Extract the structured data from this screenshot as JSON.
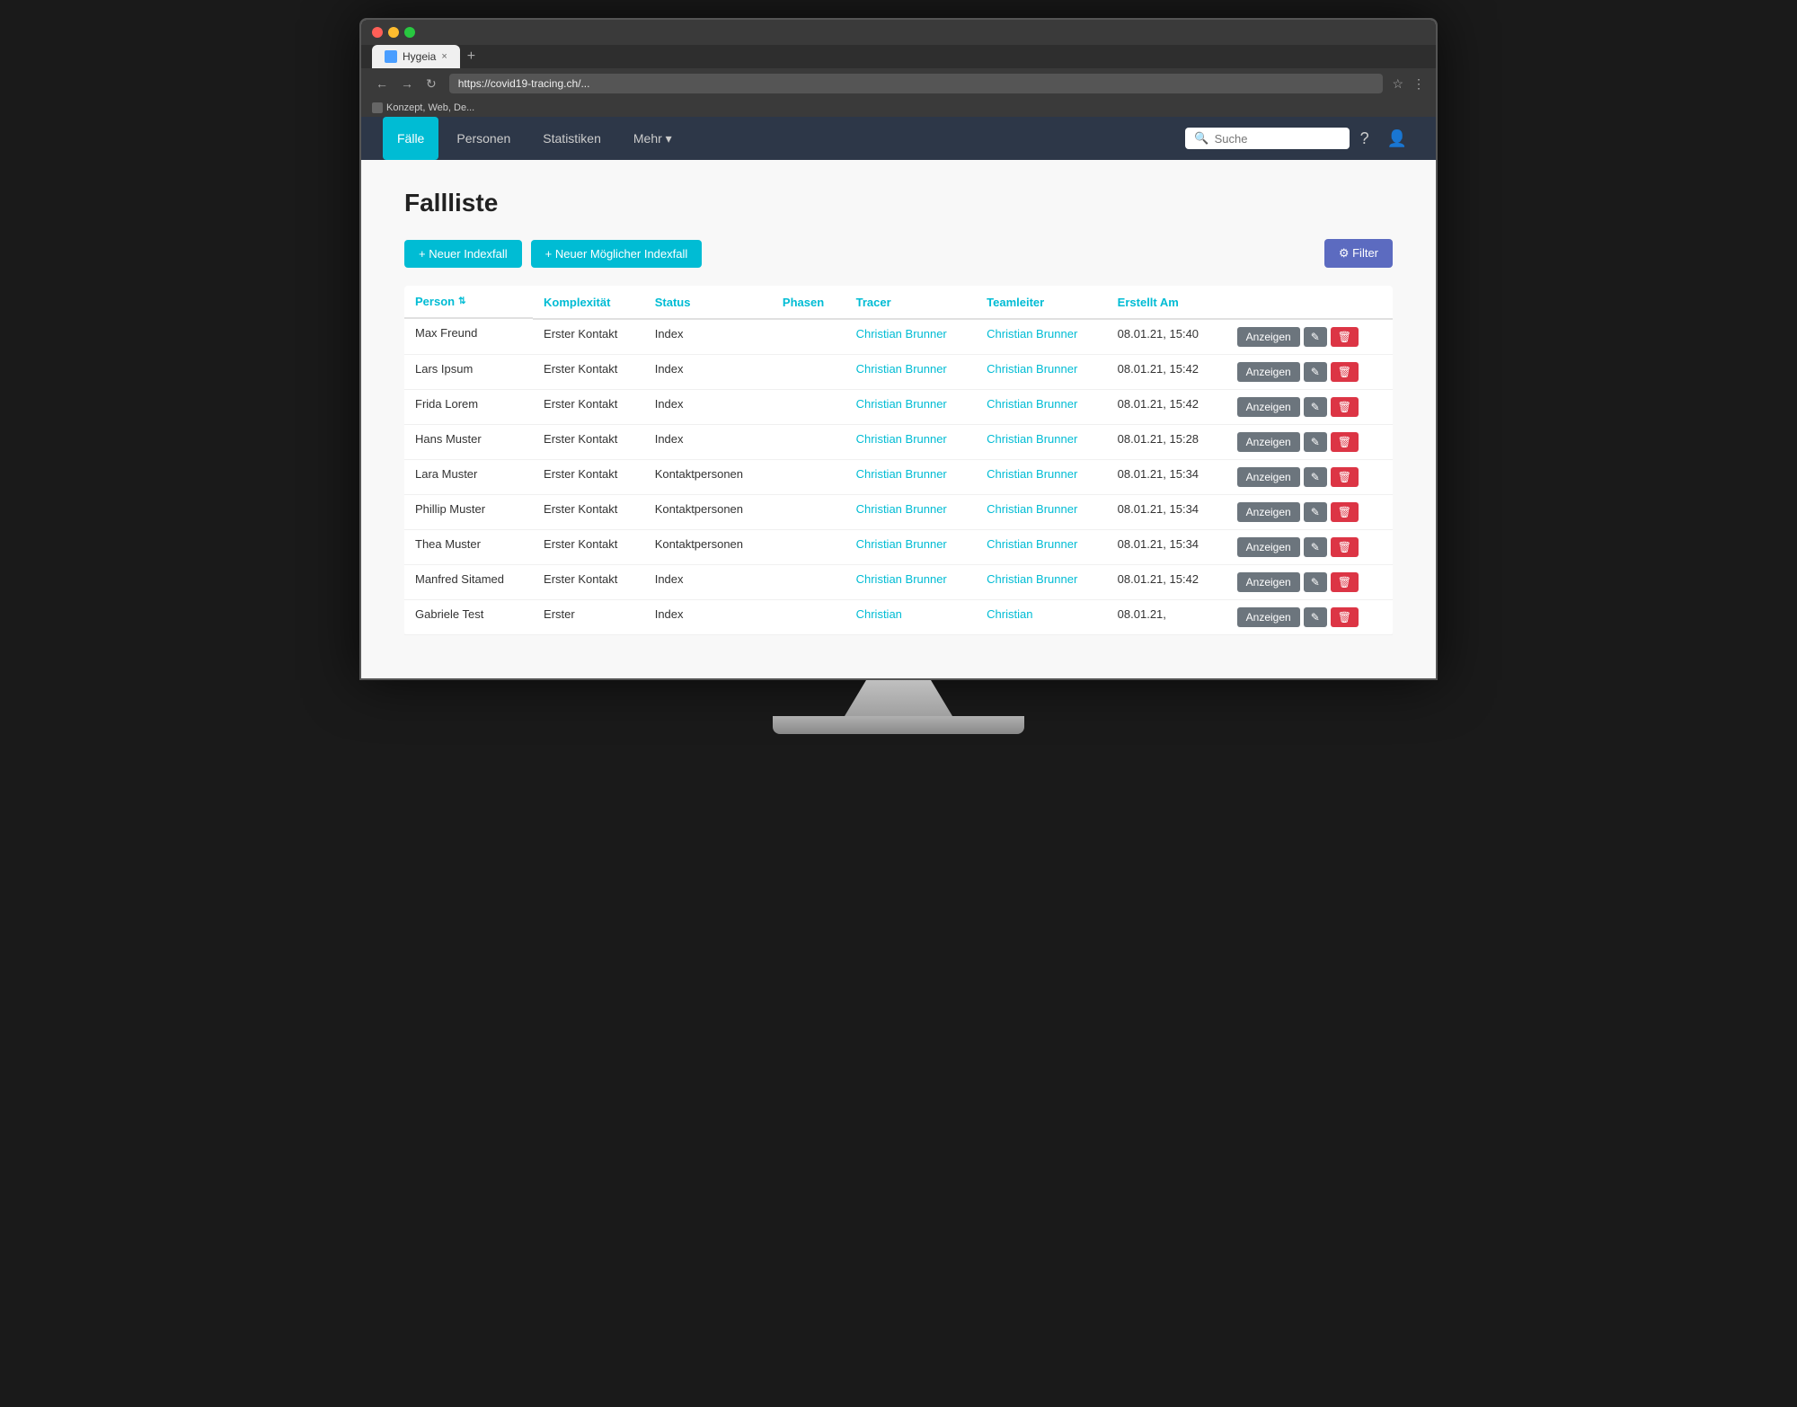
{
  "browser": {
    "tab_label": "Hygeia",
    "tab_url": "https://covid19-tracing.ch/...",
    "new_tab_symbol": "+",
    "close_symbol": "×",
    "bookmark_label": "Konzept, Web, De..."
  },
  "navbar": {
    "items": [
      {
        "id": "faelle",
        "label": "Fälle",
        "active": true
      },
      {
        "id": "personen",
        "label": "Personen",
        "active": false
      },
      {
        "id": "statistiken",
        "label": "Statistiken",
        "active": false
      },
      {
        "id": "mehr",
        "label": "Mehr ▾",
        "active": false
      }
    ],
    "search_placeholder": "Suche"
  },
  "page": {
    "title": "Fallliste"
  },
  "actions": {
    "new_index_label": "+ Neuer Indexfall",
    "new_possible_label": "+ Neuer Möglicher Indexfall",
    "filter_label": "⚙ Filter"
  },
  "table": {
    "headers": [
      {
        "id": "person",
        "label": "Person",
        "sortable": true
      },
      {
        "id": "komplexitaet",
        "label": "Komplexität",
        "sortable": false
      },
      {
        "id": "status",
        "label": "Status",
        "sortable": false
      },
      {
        "id": "phasen",
        "label": "Phasen",
        "sortable": false
      },
      {
        "id": "tracer",
        "label": "Tracer",
        "sortable": false
      },
      {
        "id": "teamleiter",
        "label": "Teamleiter",
        "sortable": false
      },
      {
        "id": "erstellt_am",
        "label": "Erstellt Am",
        "sortable": false
      },
      {
        "id": "actions",
        "label": "",
        "sortable": false
      }
    ],
    "rows": [
      {
        "person": "Max Freund",
        "komplexitaet": "Erster Kontakt",
        "status": "Index",
        "phasen": "",
        "tracer_name": "Christian Brunner",
        "teamleiter_name": "Christian Brunner",
        "erstellt_am": "08.01.21, 15:40"
      },
      {
        "person": "Lars Ipsum",
        "komplexitaet": "Erster Kontakt",
        "status": "Index",
        "phasen": "",
        "tracer_name": "Christian Brunner",
        "teamleiter_name": "Christian Brunner",
        "erstellt_am": "08.01.21, 15:42"
      },
      {
        "person": "Frida Lorem",
        "komplexitaet": "Erster Kontakt",
        "status": "Index",
        "phasen": "",
        "tracer_name": "Christian Brunner",
        "teamleiter_name": "Christian Brunner",
        "erstellt_am": "08.01.21, 15:42"
      },
      {
        "person": "Hans Muster",
        "komplexitaet": "Erster Kontakt",
        "status": "Index",
        "phasen": "",
        "tracer_name": "Christian Brunner",
        "teamleiter_name": "Christian Brunner",
        "erstellt_am": "08.01.21, 15:28"
      },
      {
        "person": "Lara Muster",
        "komplexitaet": "Erster Kontakt",
        "status": "Kontaktpersonen",
        "phasen": "",
        "tracer_name": "Christian Brunner",
        "teamleiter_name": "Christian Brunner",
        "erstellt_am": "08.01.21, 15:34"
      },
      {
        "person": "Phillip Muster",
        "komplexitaet": "Erster Kontakt",
        "status": "Kontaktpersonen",
        "phasen": "",
        "tracer_name": "Christian Brunner",
        "teamleiter_name": "Christian Brunner",
        "erstellt_am": "08.01.21, 15:34"
      },
      {
        "person": "Thea Muster",
        "komplexitaet": "Erster Kontakt",
        "status": "Kontaktpersonen",
        "phasen": "",
        "tracer_name": "Christian Brunner",
        "teamleiter_name": "Christian Brunner",
        "erstellt_am": "08.01.21, 15:34"
      },
      {
        "person": "Manfred Sitamed",
        "komplexitaet": "Erster Kontakt",
        "status": "Index",
        "phasen": "",
        "tracer_name": "Christian Brunner",
        "teamleiter_name": "Christian Brunner",
        "erstellt_am": "08.01.21, 15:42"
      },
      {
        "person": "Gabriele Test",
        "komplexitaet": "Erster",
        "status": "Index",
        "phasen": "",
        "tracer_name": "Christian",
        "teamleiter_name": "Christian",
        "erstellt_am": "08.01.21,"
      }
    ],
    "btn_anzeigen": "Anzeigen",
    "btn_edit_icon": "✎",
    "btn_delete_icon": "🗑"
  }
}
